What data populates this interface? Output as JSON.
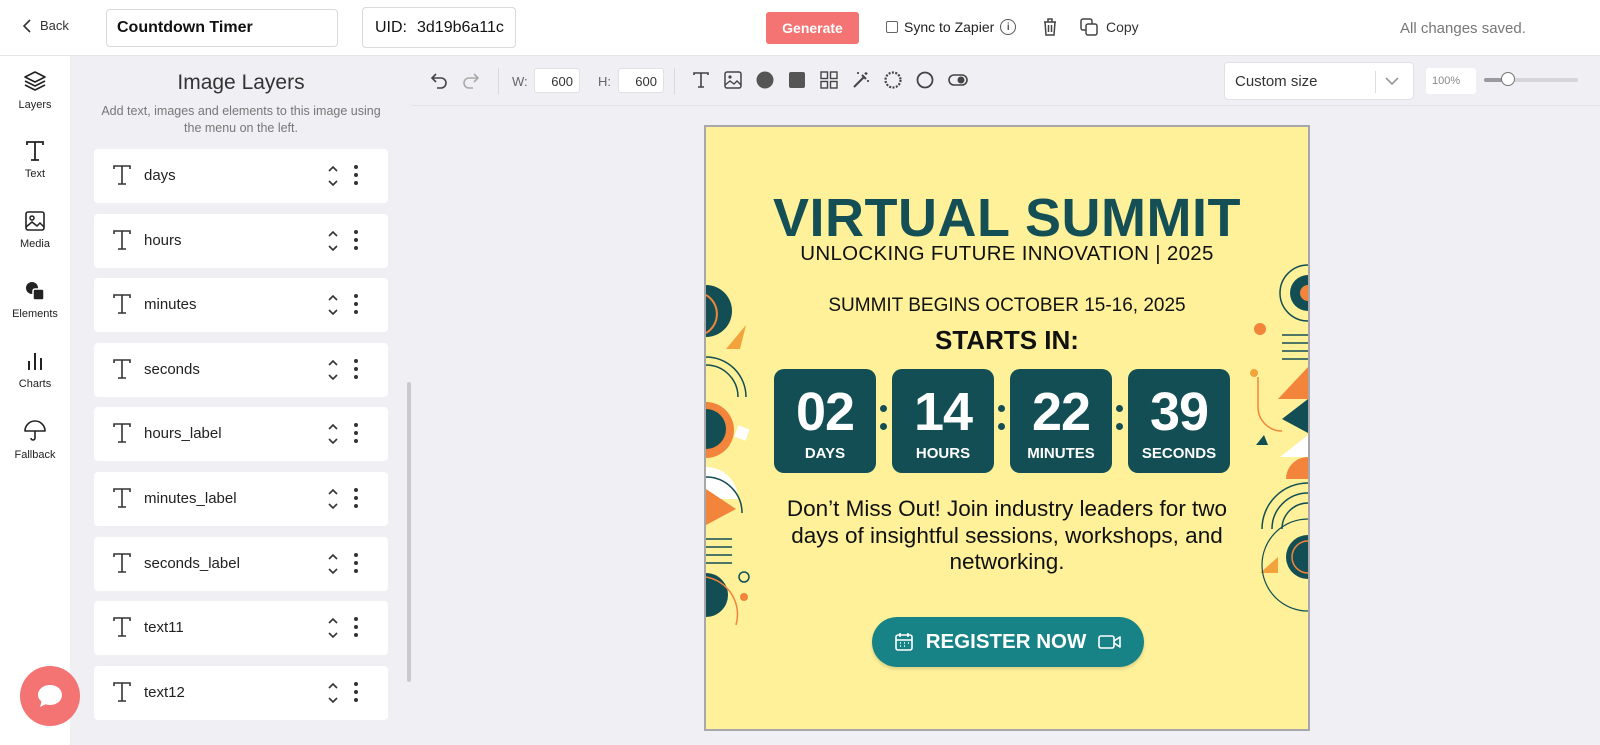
{
  "header": {
    "back_label": "Back",
    "doc_title": "Countdown Timer",
    "uid_label": "UID:",
    "uid_value": "3d19b6a11c",
    "generate_label": "Generate",
    "sync_label": "Sync to Zapier",
    "copy_label": "Copy",
    "status": "All changes saved."
  },
  "leftnav": {
    "items": [
      {
        "label": "Layers",
        "icon": "layers-icon"
      },
      {
        "label": "Text",
        "icon": "text-icon"
      },
      {
        "label": "Media",
        "icon": "image-icon"
      },
      {
        "label": "Elements",
        "icon": "shapes-icon"
      },
      {
        "label": "Charts",
        "icon": "bar-chart-icon"
      },
      {
        "label": "Fallback",
        "icon": "umbrella-icon"
      }
    ]
  },
  "panel": {
    "title": "Image Layers",
    "subtitle": "Add text, images and elements to this image using the menu on the left.",
    "layers": [
      {
        "name": "days"
      },
      {
        "name": "hours"
      },
      {
        "name": "minutes"
      },
      {
        "name": "seconds"
      },
      {
        "name": "hours_label"
      },
      {
        "name": "minutes_label"
      },
      {
        "name": "seconds_label"
      },
      {
        "name": "text11"
      },
      {
        "name": "text12"
      }
    ]
  },
  "toolbar": {
    "width_label": "W:",
    "width_value": "600",
    "height_label": "H:",
    "height_value": "600",
    "size_select": "Custom size",
    "zoom": "100%",
    "zoom_fraction": 0.25
  },
  "poster": {
    "title": "VIRTUAL SUMMIT",
    "subtitle": "UNLOCKING FUTURE INNOVATION | 2025",
    "begins": "SUMMIT BEGINS OCTOBER 15-16, 2025",
    "starts_in": "STARTS IN:",
    "countdown": [
      {
        "value": "02",
        "label": "DAYS"
      },
      {
        "value": "14",
        "label": "HOURS"
      },
      {
        "value": "22",
        "label": "MINUTES"
      },
      {
        "value": "39",
        "label": "SECONDS"
      }
    ],
    "body": "Don’t Miss Out! Join industry leaders for two days of insightful sessions, workshops, and networking.",
    "cta": "REGISTER NOW",
    "colors": {
      "background": "#fef199",
      "dark_teal": "#124e53",
      "button": "#188386",
      "orange": "#f2853b"
    }
  }
}
